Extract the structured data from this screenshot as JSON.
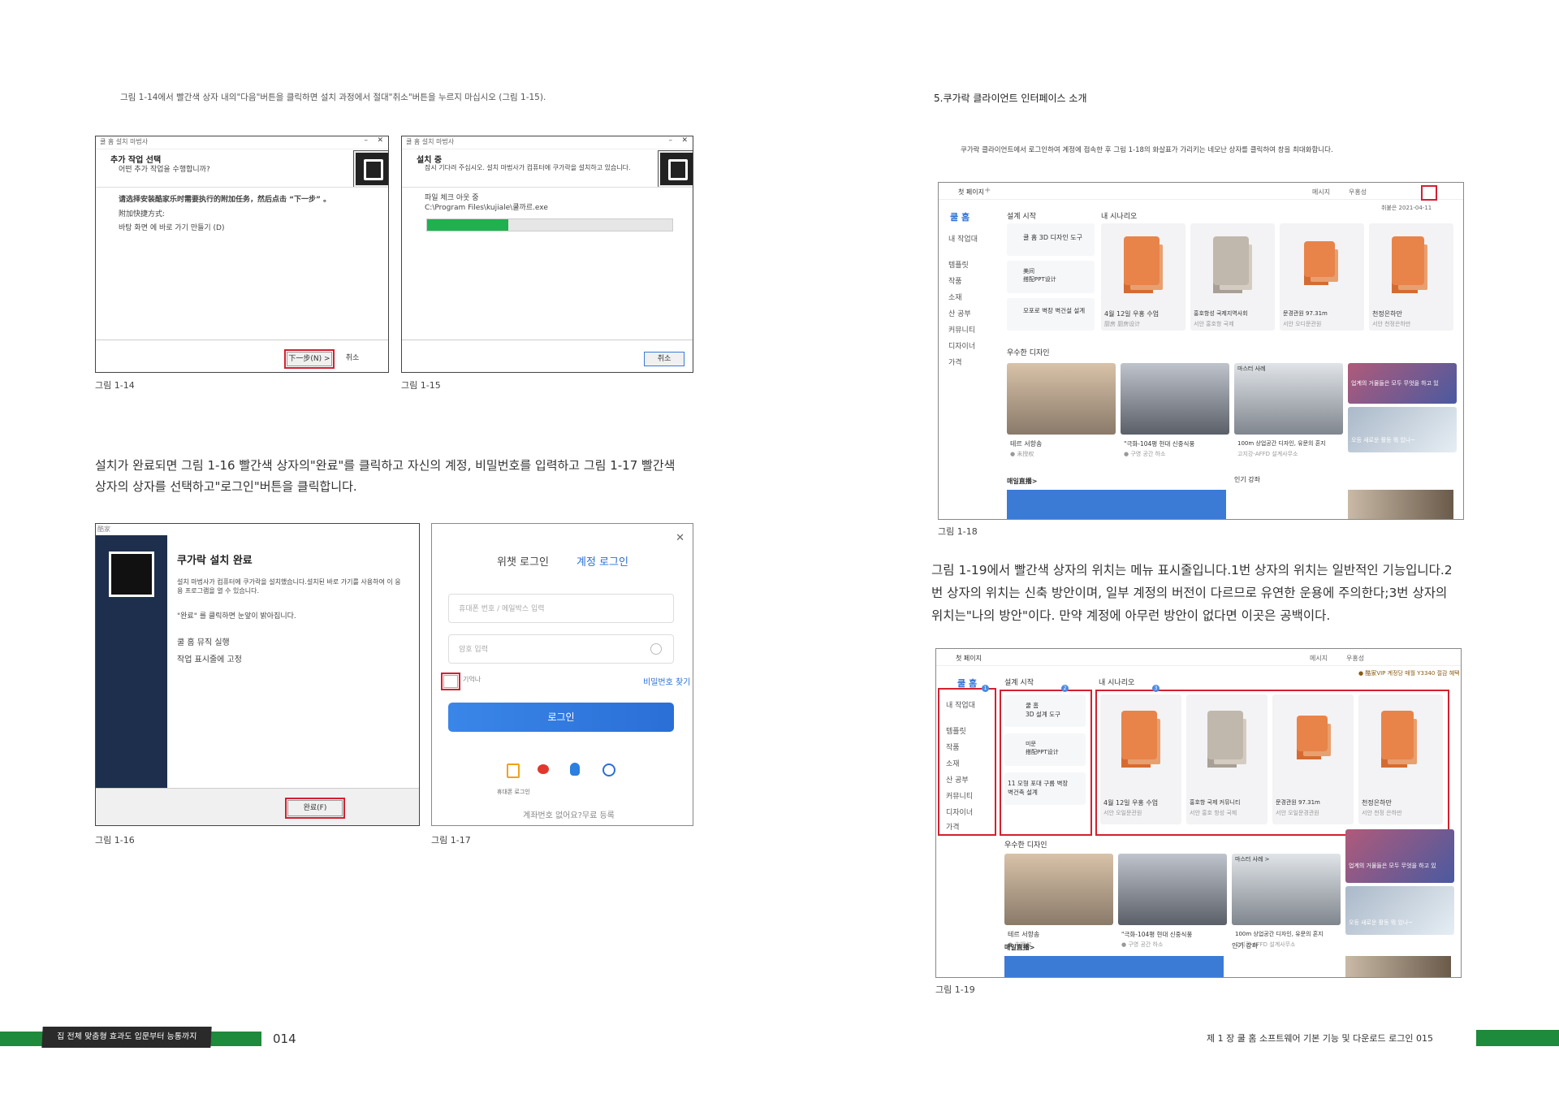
{
  "left": {
    "intro": "그림 1-14에서 빨간색 상자 내의\"다음\"버튼을 클릭하면 설치 과정에서 절대\"취소\"버튼을 누르지 마십시오 (그림 1-15).",
    "fig14": {
      "title": "쿨 홈 설치 마법사",
      "heading": "추가 작업 선택",
      "subheading": "어떤 추가 작업을 수행합니까?",
      "instruction": "请选择安装酷家乐时需要执行的附加任务，然后点击 “下一步” 。",
      "group_label": "附加快捷方式:",
      "checkbox_label": "바탕 화면 에 바로 가기 만들기 (D)",
      "next_button": "下一步(N) >",
      "cancel_button": "취소",
      "caption": "그림 1-14"
    },
    "fig15": {
      "title": "쿨 홈 설치 마법사",
      "heading": "설치 중",
      "subheading": "잠시 기다려 주십시오. 설치 마법사가 컴퓨터에 쿠가락을 설치하고 있습니다.",
      "status": "파일 체크 아웃 중",
      "path": "C:\\Program Files\\kujiale\\쿨까르.exe",
      "progress": 0.33,
      "cancel_button": "취소",
      "caption": "그림 1-15"
    },
    "para": "설치가 완료되면 그림 1-16 빨간색 상자의\"완료\"를 클릭하고 자신의 계정, 비밀번호를 입력하고 그림 1-17 빨간색 상자의 상자를 선택하고\"로그인\"버튼을 클릭합니다.",
    "fig16": {
      "title_small": "酷家",
      "heading": "쿠가락 설치 완료",
      "desc": "설치 마법사가 컴퓨터에 쿠가락을 설치했습니다.설치된 바로 가기를 사용하여 이 응용 프로그램을 열 수 있습니다.",
      "hint": "\"완료\" 를 클릭하면 눈앞이 밝아집니다.",
      "option1": "쿨 홈 뮤직 실행",
      "option2": "작업 표시줄에 고정",
      "finish_button": "완료(F)",
      "caption": "그림 1-16"
    },
    "fig17": {
      "tab_wechat": "위챗 로그인",
      "tab_account": "계정 로그인",
      "phone_placeholder": "휴대폰 번호 / 메일박스 입력",
      "password_placeholder": "암호 입력",
      "remember": "기억나",
      "forgot": "비밀번호 찾기",
      "login_button": "로그인",
      "phone_login": "휴대폰 로그인",
      "register": "계좌번호 없어요?무료 등록",
      "caption": "그림 1-17"
    },
    "footer_title": "집 전체 맞춤형 효과도 입문부터 능통까지",
    "page_number": "014"
  },
  "right": {
    "section_title": "5.쿠가락 클라이언트 인터페이스 소개",
    "intro": "쿠가락 클라이언트에서 로그인하여 계정에 접속한 후 그림 1-18의 화살표가 가리키는 네모난 상자를 클릭하여 창을 최대화합니다.",
    "fig18": {
      "tab": "첫 페이지",
      "logo": "쿨 홈",
      "top_links": [
        "메시지",
        "우홍성"
      ],
      "date": "취붙은 2021-04-11",
      "side_items": [
        "내 작업대",
        "템플릿",
        "작품",
        "소재",
        "산 공부",
        "커뮤니티",
        "디자이너",
        "가격"
      ],
      "sections": [
        "설계 시작",
        "내 시나리오",
        "우수한 디자인",
        "매일直播>",
        "인기 강좌"
      ],
      "quick": [
        "쿨 홈 3D 디자인 도구",
        "美间\n搭配PPT设计",
        "모포로 벽장 벽건설 설계"
      ],
      "scenes": [
        {
          "name": "4월 12일 우홍 수업",
          "sub": "厨房 厨房设计"
        },
        {
          "name": "홍호항성 국제지역사회",
          "sub": "서안 홍호항 국제"
        },
        {
          "name": "문경관원 97.31m",
          "sub": "서안 오디문관원"
        },
        {
          "name": "천정은하만",
          "sub": "서안 천정은하만"
        }
      ],
      "designs": [
        {
          "name": "테르 서항송",
          "sub": "● 未授权"
        },
        {
          "name": "\"극화-104평 현대 신중식풍",
          "sub": "● 구영 공간 하소"
        },
        {
          "name": "100m 상업공간 디자인, 유문의 혼지",
          "sub": "고지강-AFFD 설계사무소"
        }
      ],
      "promo1": "업계의 거물들은 모두 무엇을 하고 있",
      "promo2": "오등 새로운 활동 뭐 있나~",
      "master": "마스터 사례",
      "caption": "그림 1-18"
    },
    "para": "그림 1-19에서 빨간색 상자의 위치는 메뉴 표시줄입니다.1번 상자의 위치는 일반적인 기능입니다.2번 상자의 위치는 신축 방안이며, 일부 계정의 버전이 다르므로 유연한 운용에 주의한다;3번 상자의 위치는\"나의 방안\"이다. 만약 계정에 아무런 방안이 없다면 이곳은 공백이다.",
    "fig19": {
      "tab": "첫 페이지",
      "logo": "쿨 홈",
      "vip": "● 酷家VIP  계정당 매월 Y3340 절감 혜택",
      "top_links": [
        "메시지",
        "우홍성"
      ],
      "side_items": [
        "내 작업대",
        "템플릿",
        "작품",
        "소재",
        "산 공부",
        "커뮤니티",
        "디자이너",
        "가격"
      ],
      "sections": [
        "설계 시작",
        "내 시나리오",
        "우수한 디자인",
        "매일直播>",
        "인기 강좌"
      ],
      "quick": [
        "쿨 홈\n3D 설계 도구",
        "미문\n搭配PPT设计",
        "11 모형 포대 구름 벽장\n벽건축 설계"
      ],
      "scenes": [
        {
          "name": "4월 12일 우홍 수업",
          "sub": "서안 오일문관원"
        },
        {
          "name": "홍호항 국제 커뮤니티",
          "sub": "서안 홍호 항성 국제"
        },
        {
          "name": "문경관원 97.31m",
          "sub": "서안 오일문경관원"
        },
        {
          "name": "천정은하만",
          "sub": "서안 천정 은하만"
        }
      ],
      "designs": [
        {
          "name": "테르 서항송",
          "sub": "● 未授权"
        },
        {
          "name": "\"극화-104평 현대 신중식풍",
          "sub": "● 구영 공간 하소"
        },
        {
          "name": "100m 상업공간 디자인, 유문의 혼지",
          "sub": "고지강-AFFD 설계사무소"
        }
      ],
      "promo1": "업계의 거물들은 모두 무엇을 하고 있",
      "promo2": "오등 새로운 활동 뭐 있나~",
      "master": "마스터 사례 >",
      "badges": [
        "1",
        "2",
        "3"
      ],
      "caption": "그림 1-19"
    },
    "footer_title": "제 1 장 쿨 홈 소프트웨어 기본 기능 및 다운로드 로그인 015"
  }
}
